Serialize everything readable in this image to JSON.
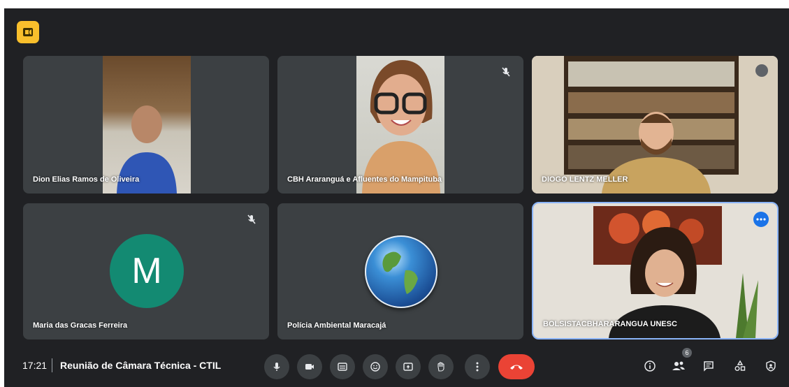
{
  "colors": {
    "background": "#202124",
    "tile": "#3c4043",
    "accent": "#8ab4f8",
    "end_call": "#ea4335",
    "avatar_m": "#138a72",
    "app_icon": "#f9bf2c"
  },
  "participants": [
    {
      "name": "Dion Elias Ramos de Oliveira",
      "muted": false,
      "type": "video"
    },
    {
      "name": "CBH Araranguá e Afluentes do Mampituba",
      "muted": true,
      "type": "video"
    },
    {
      "name": "DIOGO LENTZ MELLER",
      "muted": false,
      "type": "video"
    },
    {
      "name": "Maria das Gracas Ferreira",
      "muted": true,
      "type": "avatar",
      "avatar_letter": "M"
    },
    {
      "name": "Polícia Ambiental Maracajá",
      "muted": false,
      "type": "avatar-image",
      "avatar_image": "globe"
    },
    {
      "name": "BOLSISTACBHARARANGUA UNESC",
      "muted": false,
      "type": "video",
      "active": true
    }
  ],
  "meeting": {
    "time": "17:21",
    "separator": "|",
    "title": "Reunião de Câmara Técnica - CTIL"
  },
  "controls": {
    "center": [
      "mic-icon",
      "camera-icon",
      "captions-icon",
      "emoji-icon",
      "present-icon",
      "raise-hand-icon",
      "more-options-icon",
      "end-call-icon"
    ],
    "right": [
      "info-icon",
      "people-icon",
      "chat-icon",
      "activities-icon",
      "host-controls-icon"
    ],
    "people_count": "6"
  }
}
